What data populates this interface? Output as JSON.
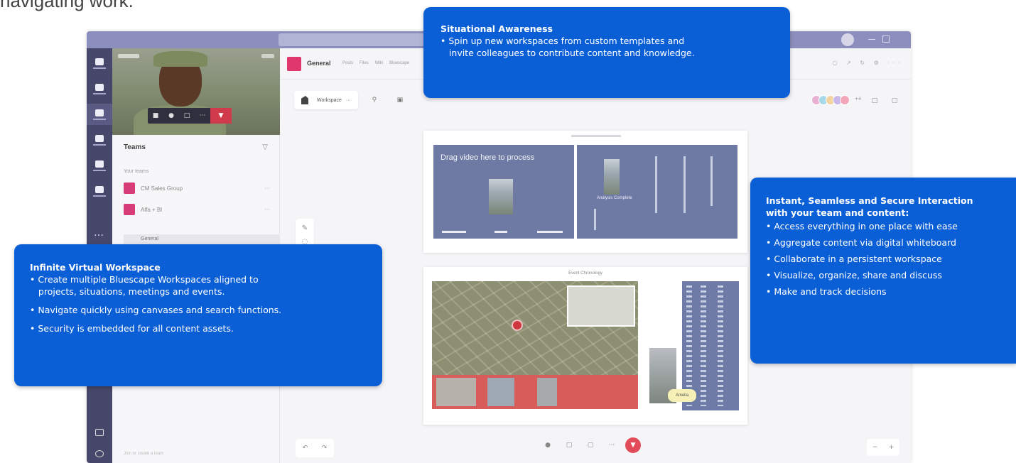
{
  "caption": "navigating work.",
  "teams_app": {
    "left_rail": {
      "items": [
        "Activity",
        "Chat",
        "Teams",
        "Calendar",
        "Calls",
        "Files"
      ],
      "more": "…"
    },
    "teams_panel": {
      "header": "Teams",
      "section": "Your teams",
      "teams": [
        {
          "name": "CM Sales Group",
          "more": "···"
        },
        {
          "name": "Alfa + Bl",
          "more": "···"
        }
      ],
      "channel": "General",
      "compose_hint": "Join or create a team"
    },
    "channel_header": {
      "title": "General",
      "tabs": [
        "Posts",
        "Files",
        "Wiki",
        "Bluescape"
      ]
    },
    "toolbar": {
      "workspace_label": "Workspace",
      "collaborator_count": "+4"
    },
    "canvas": {
      "slide_title": "Drag video here to process",
      "analysis_label": "Analysis Complete",
      "map_card_title": "Event Chronology",
      "sticky_note": "Amelia"
    }
  },
  "callouts": {
    "situational": {
      "title": "Situational Awareness",
      "lines": [
        "• Spin up new workspaces from custom templates and",
        "   invite colleagues to contribute content and knowledge."
      ]
    },
    "infinite": {
      "title": "Infinite Virtual Workspace",
      "lines": [
        "• Create multiple Bluescape Workspaces aligned to",
        "   projects, situations, meetings and events.",
        "• Navigate quickly using canvases and search functions.",
        "• Security is embedded for all content assets."
      ]
    },
    "instant": {
      "title_line1": "Instant, Seamless and Secure Interaction",
      "title_line2": "with your team and content:",
      "lines": [
        "• Access everything in one place with ease",
        "• Aggregate content via digital whiteboard",
        "• Collaborate in a persistent workspace",
        "• Visualize, organize, share and discuss",
        "• Make and track decisions"
      ]
    }
  },
  "colors": {
    "callout": "#0a5fd7",
    "teams_rail": "#47476b",
    "accent_pink": "#e0386c"
  }
}
